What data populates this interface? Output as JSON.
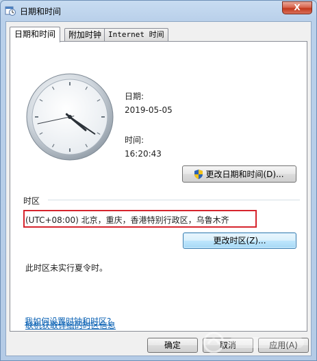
{
  "window": {
    "title": "日期和时间",
    "close_glyph": "X"
  },
  "tabs": [
    {
      "label": "日期和时间",
      "active": true
    },
    {
      "label": "附加时钟",
      "active": false
    },
    {
      "label": "Internet 时间",
      "active": false
    }
  ],
  "datetime": {
    "date_label": "日期:",
    "date_value": "2019-05-05",
    "time_label": "时间:",
    "time_value": "16:20:43",
    "change_button": "更改日期和时间(D)..."
  },
  "timezone": {
    "section_label": "时区",
    "value": "(UTC+08:00) 北京，重庆，香港特别行政区，乌鲁木齐",
    "change_button": "更改时区(Z)...",
    "dst_note": "此时区未实行夏令时。"
  },
  "links": {
    "online_info": "联机获取详细的时区信息",
    "how_to": "我如何设置时钟和时区?"
  },
  "footer": {
    "ok": "确定",
    "cancel": "取消",
    "apply": "应用(A)"
  },
  "clock_face": {
    "hour": 16,
    "minute": 20,
    "second": 43
  }
}
